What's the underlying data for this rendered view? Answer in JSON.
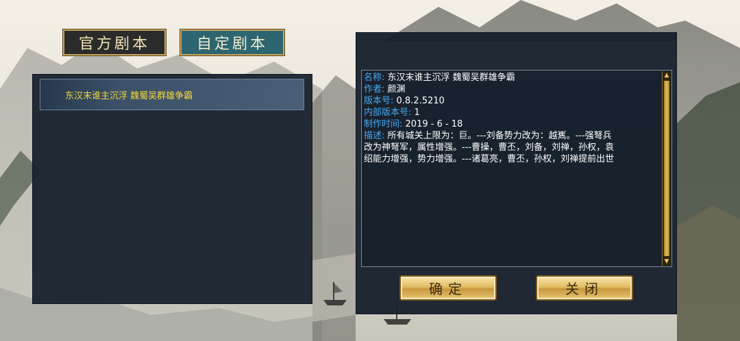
{
  "tabs": {
    "official": "官方剧本",
    "custom": "自定剧本"
  },
  "scenario_list": [
    {
      "title": "东汉末谁主沉浮  魏蜀吴群雄争霸"
    }
  ],
  "details": {
    "name_label": "名称:",
    "name_value": " 东汉末谁主沉浮  魏蜀吴群雄争霸",
    "author_label": "作者:",
    "author_value": " 颜渊",
    "version_label": "版本号:",
    "version_value": " 0.8.2.5210",
    "internal_version_label": "内部版本号:",
    "internal_version_value": " 1",
    "made_time_label": "制作时间:",
    "made_time_value": " 2019 - 6 - 18",
    "desc_label": "描述:",
    "desc_line1": " 所有城关上限为：巨。---刘备势力改为：越嶲。---强弩兵",
    "desc_line2": "改为神弩军，属性增强。---曹操，曹丕，刘备，刘禅，孙权，袁",
    "desc_line3": "绍能力增强，势力增强。---诸葛亮，曹丕，孙权，刘禅提前出世"
  },
  "buttons": {
    "confirm": "确定",
    "close": "关闭"
  },
  "colors": {
    "label_blue": "#4aa8f0",
    "list_title_yellow": "#f4d83e",
    "tab_custom_bg": "#2d6670",
    "gold": "#e3bd63"
  }
}
